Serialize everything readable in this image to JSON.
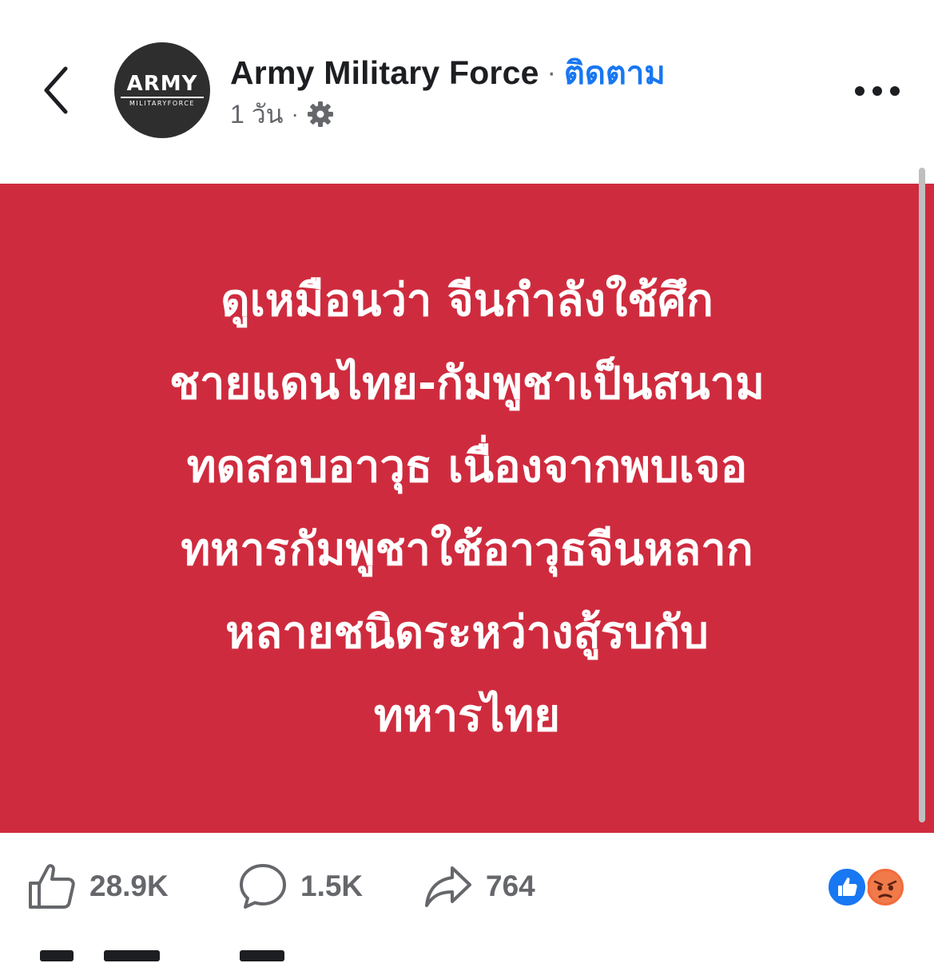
{
  "header": {
    "page_name": "Army Military Force",
    "separator": "·",
    "follow_label": "ติดตาม",
    "time_label": "1 วัน",
    "meta_separator": "·",
    "avatar": {
      "logo_main": "ARMY",
      "logo_sub": "MILITARYFORCE"
    },
    "icons": {
      "back": "chevron-left-icon",
      "privacy": "gear-icon",
      "more": "more-dots-icon"
    }
  },
  "post": {
    "background_color": "#cf2b3e",
    "text_color": "#ffffff",
    "lines": [
      "ดูเหมือนว่า จีนกำลังใช้ศึก",
      "ชายแดนไทย-กัมพูชาเป็นสนาม",
      "ทดสอบอาวุธ เนื่องจากพบเจอ",
      "ทหารกัมพูชาใช้อาวุธจีนหลาก",
      "หลายชนิดระหว่างสู้รบกับ",
      "ทหารไทย"
    ]
  },
  "actions": {
    "like_count": "28.9K",
    "comment_count": "1.5K",
    "share_count": "764",
    "reactions": [
      "like",
      "angry"
    ]
  },
  "colors": {
    "accent": "#1877f2",
    "secondary_text": "#65676b",
    "primary_text": "#1c1e21"
  }
}
